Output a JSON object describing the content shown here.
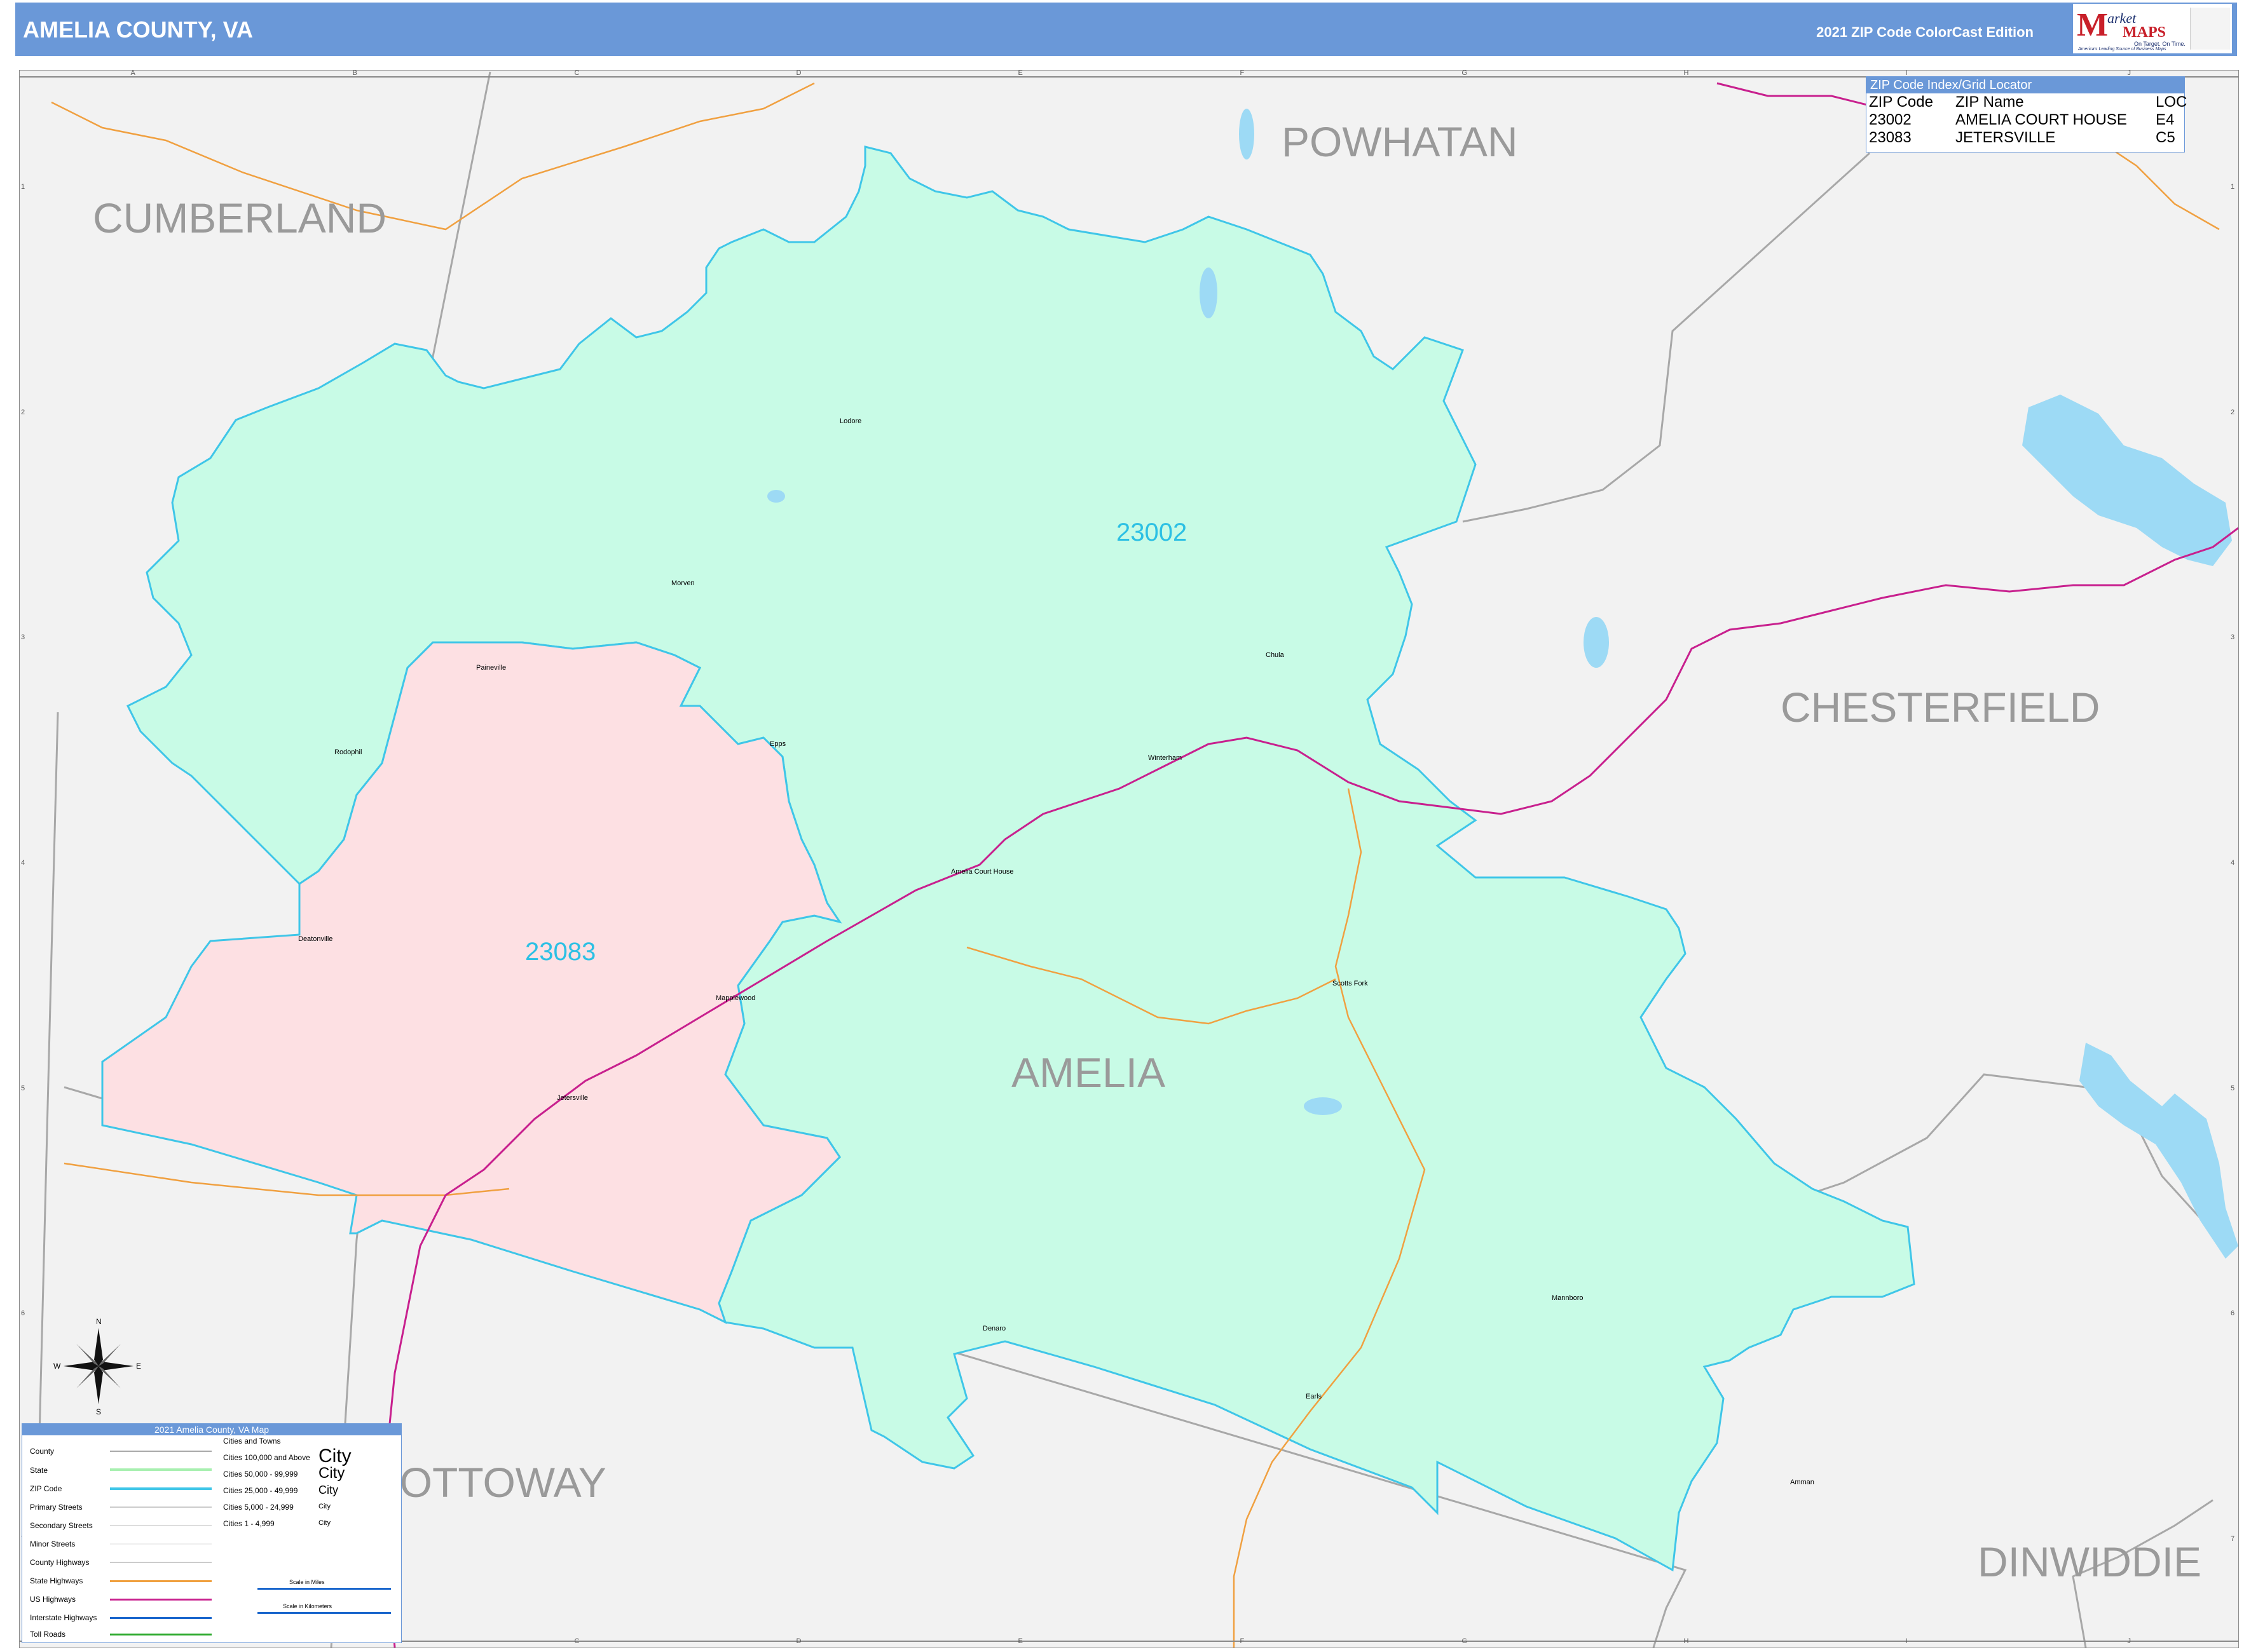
{
  "header": {
    "title": "AMELIA COUNTY, VA",
    "edition": "2021 ZIP Code ColorCast Edition",
    "logo": {
      "brand_part1": "arket",
      "brand_part2": "MAPS",
      "tagline": "On Target. On Time.",
      "subtagline": "America's Leading Source of Business Maps"
    }
  },
  "colors": {
    "header": "#6a98d8",
    "zip_23002_fill": "#c8fbe6",
    "zip_23083_fill": "#fde0e3",
    "zip_border": "#3fc6e8",
    "background_land": "#f2f2f2",
    "water": "#9ddaf5",
    "us_highway": "#c8208e",
    "state_highway": "#f0a040",
    "county_line": "#a8a8a8"
  },
  "grid": {
    "columns": [
      "A",
      "B",
      "C",
      "D",
      "E",
      "F",
      "G",
      "H",
      "I",
      "J"
    ],
    "rows": [
      "1",
      "2",
      "3",
      "4",
      "5",
      "6",
      "7"
    ]
  },
  "map_labels": {
    "counties": [
      "CUMBERLAND",
      "POWHATAN",
      "CHESTERFIELD",
      "AMELIA",
      "NOTTOWAY",
      "DINWIDDIE"
    ],
    "zips": [
      "23002",
      "23083"
    ],
    "places": [
      "Lodore",
      "Morven",
      "Paineville",
      "Chula",
      "Rodophil",
      "Epps",
      "Winterham",
      "Amelia Court House",
      "Deatonville",
      "Mapplewood",
      "Scotts Fork",
      "Jetersville",
      "Denaro",
      "Mannboro",
      "Earls",
      "Amman"
    ]
  },
  "zip_index": {
    "title": "ZIP Code Index/Grid Locator",
    "headers": [
      "ZIP Code",
      "ZIP Name",
      "LOC"
    ],
    "rows": [
      [
        "23002",
        "AMELIA COURT HOUSE",
        "E4"
      ],
      [
        "23083",
        "JETERSVILLE",
        "C5"
      ]
    ]
  },
  "legend": {
    "title": "2021 Amelia County, VA Map",
    "items": [
      "County",
      "State",
      "ZIP Code",
      "Primary Streets",
      "Secondary Streets",
      "Minor Streets",
      "County Highways",
      "State Highways",
      "US Highways",
      "Interstate Highways",
      "Toll Roads"
    ],
    "cities_heading": "Cities and Towns",
    "city_classes": [
      "Cities 100,000 and Above",
      "Cities 50,000 - 99,999",
      "Cities 25,000 - 49,999",
      "Cities 5,000 - 24,999",
      "Cities 1 - 4,999"
    ],
    "city_sample": "City",
    "scale_miles": "Scale in Miles",
    "scale_km": "Scale in Kilometers"
  },
  "compass": {
    "n": "N",
    "s": "S",
    "e": "E",
    "w": "W"
  }
}
